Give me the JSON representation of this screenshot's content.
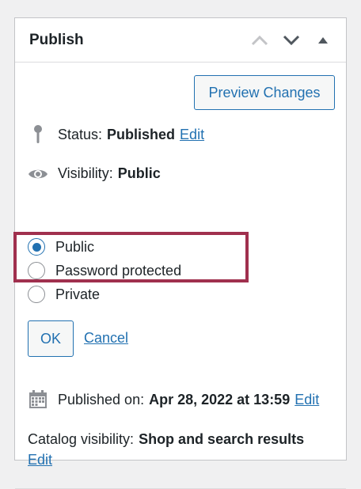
{
  "panel": {
    "title": "Publish",
    "actions": [
      {
        "name": "move-up",
        "icon": "chevron-up-icon"
      },
      {
        "name": "move-down",
        "icon": "chevron-down-icon"
      },
      {
        "name": "toggle-panel",
        "icon": "triangle-up-icon"
      }
    ]
  },
  "preview_label": "Preview Changes",
  "status": {
    "label": "Status:",
    "value": "Published",
    "edit": "Edit"
  },
  "visibility": {
    "label": "Visibility:",
    "value": "Public",
    "options": [
      {
        "label": "Public",
        "checked": true
      },
      {
        "label": "Password protected",
        "checked": false
      },
      {
        "label": "Private",
        "checked": false
      }
    ],
    "ok": "OK",
    "cancel": "Cancel"
  },
  "published": {
    "label": "Published on:",
    "value": "Apr 28, 2022 at 13:59",
    "edit": "Edit"
  },
  "catalog": {
    "label": "Catalog visibility:",
    "value": "Shop and search results",
    "edit": "Edit"
  },
  "colors": {
    "accent": "#2271b1",
    "highlight": "#a0304e",
    "icon": "#8c8f94"
  }
}
